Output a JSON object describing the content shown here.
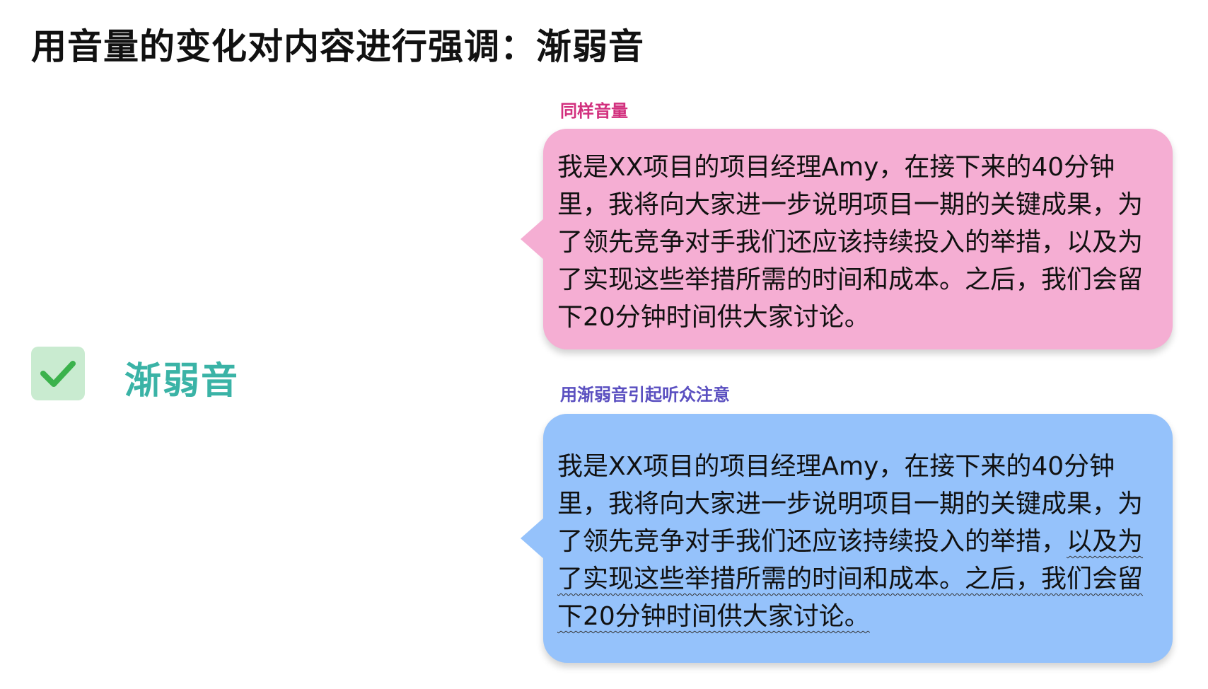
{
  "page_title": "用音量的变化对内容进行强调：渐弱音",
  "left_panel": {
    "icon": "check-icon",
    "label": "渐弱音",
    "colors": {
      "check_bg": "#c9ebd0",
      "check_mark": "#3bb24c",
      "label": "#3ab3a6"
    }
  },
  "bubbles": [
    {
      "caption": "同样音量",
      "caption_color": "#d2307e",
      "bg_color": "#f5aed3",
      "text": "我是XX项目的项目经理Amy，在接下来的40分钟里，我将向大家进一步说明项目一期的关键成果，为了领先竞争对手我们还应该持续投入的举措，以及为了实现这些举措所需的时间和成本。之后，我们会留下20分钟时间供大家讨论。"
    },
    {
      "caption": "用渐弱音引起听众注意",
      "caption_color": "#5a4fc0",
      "bg_color": "#95c2fb",
      "text_plain": "我是XX项目的项目经理Amy，在接下来的40分钟里，我将向大家进一步说明项目一期的关键成果，为了领先竞争对手我们还应该持续投入的举措，",
      "text_emphasized": "以及为了实现这些举措所需的时间和成本。之后，我们会留下20分钟时间供大家讨论。"
    }
  ]
}
